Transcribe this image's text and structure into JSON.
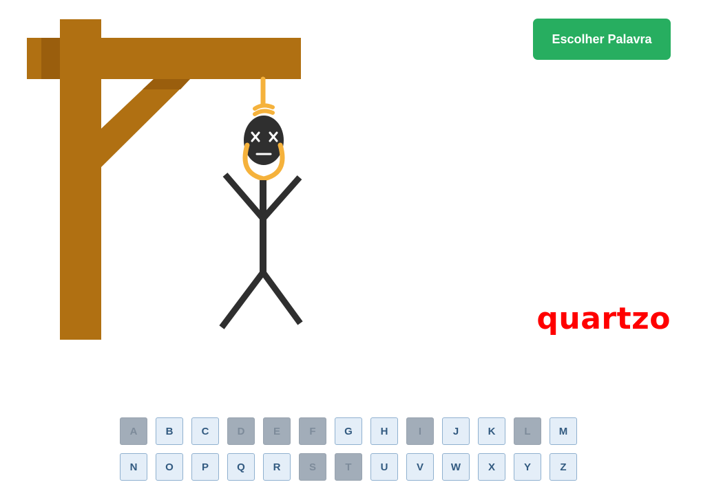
{
  "colors": {
    "wood": "#b07012",
    "wood_shadow": "#9a5e0d",
    "rope": "#f5b23c",
    "figure": "#2f2f2f",
    "face_marks": "#ffffff",
    "button": "#27ae60",
    "word": "#ff0000"
  },
  "controls": {
    "choose_word_label": "Escolher Palavra"
  },
  "game": {
    "word": "quartzo",
    "hangman_state": "complete"
  },
  "keyboard": {
    "rows": [
      [
        {
          "letter": "A",
          "used": true
        },
        {
          "letter": "B",
          "used": false
        },
        {
          "letter": "C",
          "used": false
        },
        {
          "letter": "D",
          "used": true
        },
        {
          "letter": "E",
          "used": true
        },
        {
          "letter": "F",
          "used": true
        },
        {
          "letter": "G",
          "used": false
        },
        {
          "letter": "H",
          "used": false
        },
        {
          "letter": "I",
          "used": true
        },
        {
          "letter": "J",
          "used": false
        },
        {
          "letter": "K",
          "used": false
        },
        {
          "letter": "L",
          "used": true
        },
        {
          "letter": "M",
          "used": false
        }
      ],
      [
        {
          "letter": "N",
          "used": false
        },
        {
          "letter": "O",
          "used": false
        },
        {
          "letter": "P",
          "used": false
        },
        {
          "letter": "Q",
          "used": false
        },
        {
          "letter": "R",
          "used": false
        },
        {
          "letter": "S",
          "used": true
        },
        {
          "letter": "T",
          "used": true
        },
        {
          "letter": "U",
          "used": false
        },
        {
          "letter": "V",
          "used": false
        },
        {
          "letter": "W",
          "used": false
        },
        {
          "letter": "X",
          "used": false
        },
        {
          "letter": "Y",
          "used": false
        },
        {
          "letter": "Z",
          "used": false
        }
      ]
    ]
  }
}
